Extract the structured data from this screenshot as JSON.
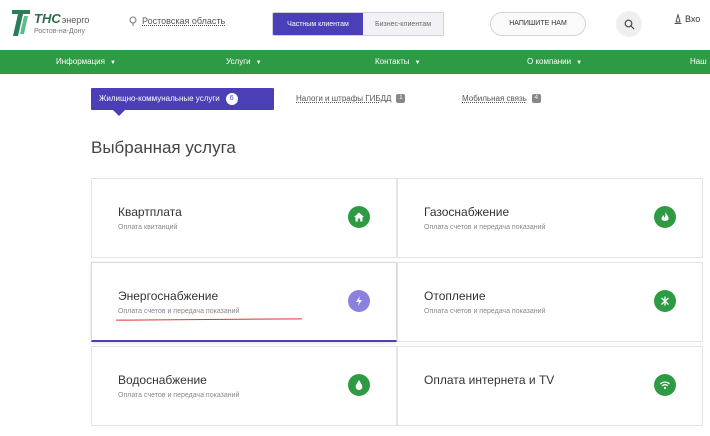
{
  "header": {
    "logo_main": "ТНС",
    "logo_suffix": "энерго",
    "logo_sub": "Ростов-на-Дону",
    "region": "Ростовская область",
    "toggle_active": "Частным клиентам",
    "toggle_inactive": "Бизнес-клиентам",
    "write_button": "НАПИШИТЕ НАМ",
    "login_label": "Вхо"
  },
  "nav": {
    "items": [
      {
        "label": "Информация"
      },
      {
        "label": "Услуги"
      },
      {
        "label": "Контакты"
      },
      {
        "label": "О компании"
      },
      {
        "label": "Наш"
      }
    ]
  },
  "subtabs": {
    "active_label": "Жилищно-коммунальные услуги",
    "active_badge": "6",
    "second_label": "Налоги и штрафы ГИБДД",
    "second_badge": "1",
    "third_label": "Мобильная связь",
    "third_badge": "4"
  },
  "page_title": "Выбранная услуга",
  "cards": [
    {
      "title": "Квартплата",
      "subtitle": "Оплата квитанций",
      "icon": "home-icon"
    },
    {
      "title": "Газоснабжение",
      "subtitle": "Оплата счетов и передача показаний",
      "icon": "flame-icon"
    },
    {
      "title": "Энергоснабжение",
      "subtitle": "Оплата счетов и передача показаний",
      "icon": "lightning-icon"
    },
    {
      "title": "Отопление",
      "subtitle": "Оплата счетов и передача показаний",
      "icon": "radiator-icon"
    },
    {
      "title": "Водоснабжение",
      "subtitle": "Оплата счетов и передача показаний",
      "icon": "water-drop-icon"
    },
    {
      "title": "Оплата интернета и TV",
      "subtitle": "",
      "icon": "wifi-icon"
    }
  ],
  "colors": {
    "brand_green": "#2e9a43",
    "accent_purple": "#4b3fb7",
    "highlight_red": "#dd3333"
  }
}
